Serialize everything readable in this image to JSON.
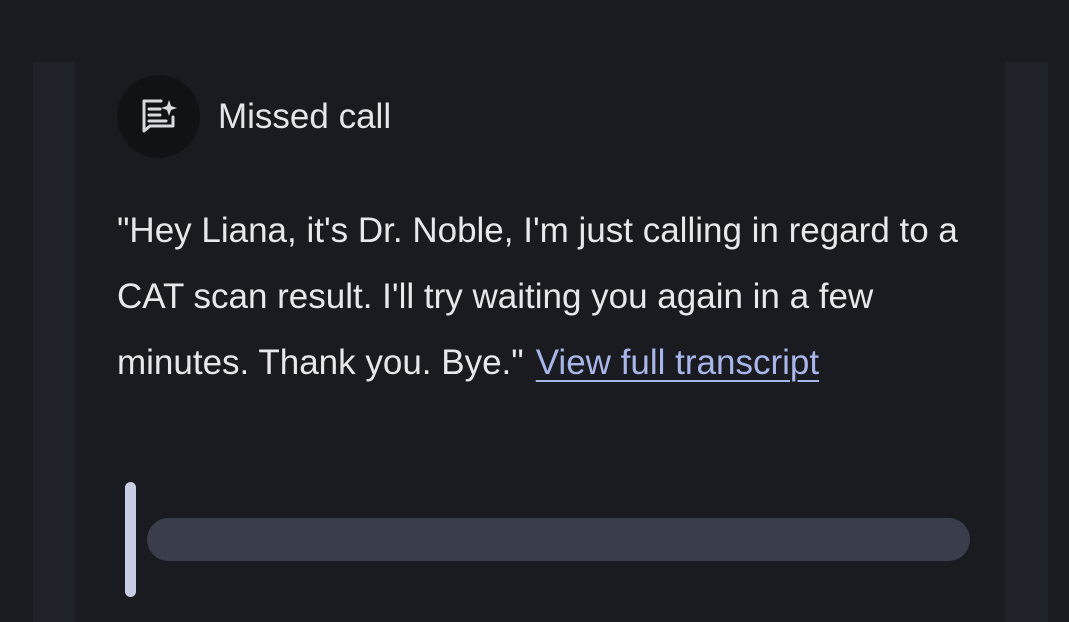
{
  "card": {
    "title": "Missed call",
    "icon": "transcript-sparkle-icon",
    "transcript_text": "\"Hey Liana, it's Dr. Noble, I'm just calling in regard to a CAT scan result. I'll try waiting you again in a few minutes. Thank you. Bye.\"",
    "view_transcript_label": "View full transcript"
  },
  "player": {
    "progress": 0
  },
  "colors": {
    "background": "#1a1b20",
    "side_panel": "#1f2229",
    "text": "#e8e8ec",
    "link": "#a9b6ea",
    "track": "#3a3e4c",
    "handle": "#c9cde6"
  }
}
